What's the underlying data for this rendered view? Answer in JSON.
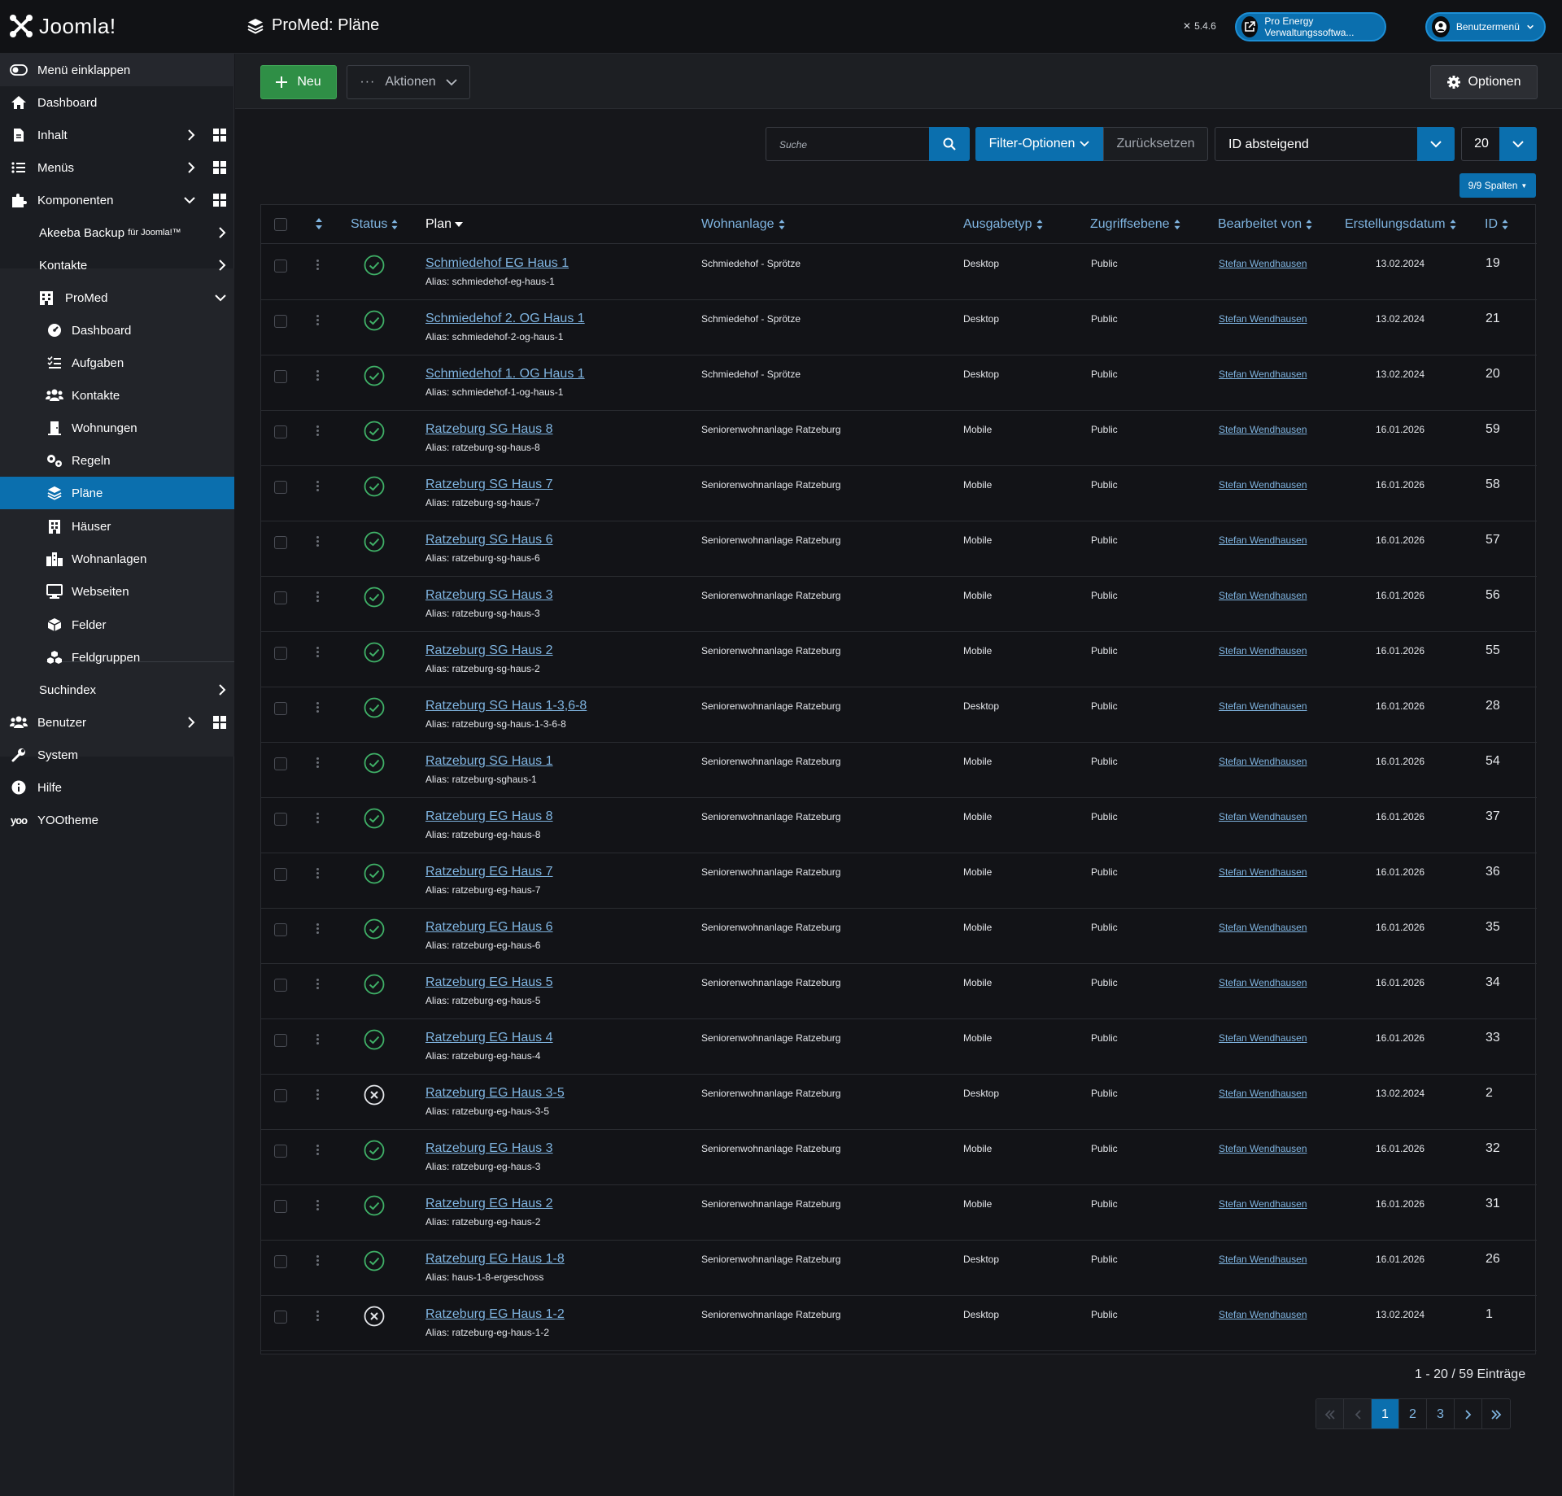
{
  "header": {
    "logo_text": "Joomla!",
    "title": "ProMed: Pläne",
    "version": "5.4.6",
    "site_button": "Pro Energy Verwaltungssoftwa...",
    "user_menu": "Benutzermenü"
  },
  "sidebar": {
    "collapse": "Menü einklappen",
    "dashboard": "Dashboard",
    "content": "Inhalt",
    "menus": "Menüs",
    "components": "Komponenten",
    "akeeba": "Akeeba Backup",
    "akeeba_suffix": "für Joomla!™",
    "contacts": "Kontakte",
    "promed": "ProMed",
    "promed_items": [
      "Dashboard",
      "Aufgaben",
      "Kontakte",
      "Wohnungen",
      "Regeln",
      "Pläne",
      "Häuser",
      "Wohnanlagen",
      "Webseiten",
      "Felder",
      "Feldgruppen"
    ],
    "smartsearch": "Suchindex",
    "users": "Benutzer",
    "system": "System",
    "help": "Hilfe",
    "yootheme": "YOOtheme"
  },
  "toolbar": {
    "new": "Neu",
    "actions": "Aktionen",
    "options": "Optionen"
  },
  "filters": {
    "search_placeholder": "Suche",
    "filter_options": "Filter-Optionen",
    "reset": "Zurücksetzen",
    "sort": "ID absteigend",
    "limit": "20",
    "columns": "9/9 Spalten"
  },
  "table": {
    "headers": {
      "status": "Status",
      "plan": "Plan",
      "complex": "Wohnanlage",
      "output": "Ausgabetyp",
      "access": "Zugriffsebene",
      "editor": "Bearbeitet von",
      "created": "Erstellungsdatum",
      "id": "ID"
    },
    "rows": [
      {
        "published": true,
        "title": "Schmiedehof EG Haus 1",
        "alias": "Alias: schmiedehof-eg-haus-1",
        "complex": "Schmiedehof - Sprötze",
        "output": "Desktop",
        "access": "Public",
        "editor": "Stefan Wendhausen",
        "created": "13.02.2024",
        "id": "19"
      },
      {
        "published": true,
        "title": "Schmiedehof 2. OG Haus 1",
        "alias": "Alias: schmiedehof-2-og-haus-1",
        "complex": "Schmiedehof - Sprötze",
        "output": "Desktop",
        "access": "Public",
        "editor": "Stefan Wendhausen",
        "created": "13.02.2024",
        "id": "21"
      },
      {
        "published": true,
        "title": "Schmiedehof 1. OG Haus 1",
        "alias": "Alias: schmiedehof-1-og-haus-1",
        "complex": "Schmiedehof - Sprötze",
        "output": "Desktop",
        "access": "Public",
        "editor": "Stefan Wendhausen",
        "created": "13.02.2024",
        "id": "20"
      },
      {
        "published": true,
        "title": "Ratzeburg SG Haus 8",
        "alias": "Alias: ratzeburg-sg-haus-8",
        "complex": "Seniorenwohnanlage Ratzeburg",
        "output": "Mobile",
        "access": "Public",
        "editor": "Stefan Wendhausen",
        "created": "16.01.2026",
        "id": "59"
      },
      {
        "published": true,
        "title": "Ratzeburg SG Haus 7",
        "alias": "Alias: ratzeburg-sg-haus-7",
        "complex": "Seniorenwohnanlage Ratzeburg",
        "output": "Mobile",
        "access": "Public",
        "editor": "Stefan Wendhausen",
        "created": "16.01.2026",
        "id": "58"
      },
      {
        "published": true,
        "title": "Ratzeburg SG Haus 6",
        "alias": "Alias: ratzeburg-sg-haus-6",
        "complex": "Seniorenwohnanlage Ratzeburg",
        "output": "Mobile",
        "access": "Public",
        "editor": "Stefan Wendhausen",
        "created": "16.01.2026",
        "id": "57"
      },
      {
        "published": true,
        "title": "Ratzeburg SG Haus 3",
        "alias": "Alias: ratzeburg-sg-haus-3",
        "complex": "Seniorenwohnanlage Ratzeburg",
        "output": "Mobile",
        "access": "Public",
        "editor": "Stefan Wendhausen",
        "created": "16.01.2026",
        "id": "56"
      },
      {
        "published": true,
        "title": "Ratzeburg SG Haus 2",
        "alias": "Alias: ratzeburg-sg-haus-2",
        "complex": "Seniorenwohnanlage Ratzeburg",
        "output": "Mobile",
        "access": "Public",
        "editor": "Stefan Wendhausen",
        "created": "16.01.2026",
        "id": "55"
      },
      {
        "published": true,
        "title": "Ratzeburg SG Haus 1-3,6-8",
        "alias": "Alias: ratzeburg-sg-haus-1-3-6-8",
        "complex": "Seniorenwohnanlage Ratzeburg",
        "output": "Desktop",
        "access": "Public",
        "editor": "Stefan Wendhausen",
        "created": "16.01.2026",
        "id": "28"
      },
      {
        "published": true,
        "title": "Ratzeburg SG Haus 1",
        "alias": "Alias: ratzeburg-sghaus-1",
        "complex": "Seniorenwohnanlage Ratzeburg",
        "output": "Mobile",
        "access": "Public",
        "editor": "Stefan Wendhausen",
        "created": "16.01.2026",
        "id": "54"
      },
      {
        "published": true,
        "title": "Ratzeburg EG Haus 8",
        "alias": "Alias: ratzeburg-eg-haus-8",
        "complex": "Seniorenwohnanlage Ratzeburg",
        "output": "Mobile",
        "access": "Public",
        "editor": "Stefan Wendhausen",
        "created": "16.01.2026",
        "id": "37"
      },
      {
        "published": true,
        "title": "Ratzeburg EG Haus 7",
        "alias": "Alias: ratzeburg-eg-haus-7",
        "complex": "Seniorenwohnanlage Ratzeburg",
        "output": "Mobile",
        "access": "Public",
        "editor": "Stefan Wendhausen",
        "created": "16.01.2026",
        "id": "36"
      },
      {
        "published": true,
        "title": "Ratzeburg EG Haus 6",
        "alias": "Alias: ratzeburg-eg-haus-6",
        "complex": "Seniorenwohnanlage Ratzeburg",
        "output": "Mobile",
        "access": "Public",
        "editor": "Stefan Wendhausen",
        "created": "16.01.2026",
        "id": "35"
      },
      {
        "published": true,
        "title": "Ratzeburg EG Haus 5",
        "alias": "Alias: ratzeburg-eg-haus-5",
        "complex": "Seniorenwohnanlage Ratzeburg",
        "output": "Mobile",
        "access": "Public",
        "editor": "Stefan Wendhausen",
        "created": "16.01.2026",
        "id": "34"
      },
      {
        "published": true,
        "title": "Ratzeburg EG Haus 4",
        "alias": "Alias: ratzeburg-eg-haus-4",
        "complex": "Seniorenwohnanlage Ratzeburg",
        "output": "Mobile",
        "access": "Public",
        "editor": "Stefan Wendhausen",
        "created": "16.01.2026",
        "id": "33"
      },
      {
        "published": false,
        "title": "Ratzeburg EG Haus 3-5",
        "alias": "Alias: ratzeburg-eg-haus-3-5",
        "complex": "Seniorenwohnanlage Ratzeburg",
        "output": "Desktop",
        "access": "Public",
        "editor": "Stefan Wendhausen",
        "created": "13.02.2024",
        "id": "2"
      },
      {
        "published": true,
        "title": "Ratzeburg EG Haus 3",
        "alias": "Alias: ratzeburg-eg-haus-3",
        "complex": "Seniorenwohnanlage Ratzeburg",
        "output": "Mobile",
        "access": "Public",
        "editor": "Stefan Wendhausen",
        "created": "16.01.2026",
        "id": "32"
      },
      {
        "published": true,
        "title": "Ratzeburg EG Haus 2",
        "alias": "Alias: ratzeburg-eg-haus-2",
        "complex": "Seniorenwohnanlage Ratzeburg",
        "output": "Mobile",
        "access": "Public",
        "editor": "Stefan Wendhausen",
        "created": "16.01.2026",
        "id": "31"
      },
      {
        "published": true,
        "title": "Ratzeburg EG Haus 1-8",
        "alias": "Alias: haus-1-8-ergeschoss",
        "complex": "Seniorenwohnanlage Ratzeburg",
        "output": "Desktop",
        "access": "Public",
        "editor": "Stefan Wendhausen",
        "created": "16.01.2026",
        "id": "26"
      },
      {
        "published": false,
        "title": "Ratzeburg EG Haus 1-2",
        "alias": "Alias: ratzeburg-eg-haus-1-2",
        "complex": "Seniorenwohnanlage Ratzeburg",
        "output": "Desktop",
        "access": "Public",
        "editor": "Stefan Wendhausen",
        "created": "13.02.2024",
        "id": "1"
      }
    ]
  },
  "pagination": {
    "count": "1 - 20 / 59 Einträge",
    "pages": [
      "1",
      "2",
      "3"
    ]
  },
  "colors": {
    "accent": "#0b6fae",
    "success": "#2f8f46",
    "link": "#7fb4e0"
  }
}
